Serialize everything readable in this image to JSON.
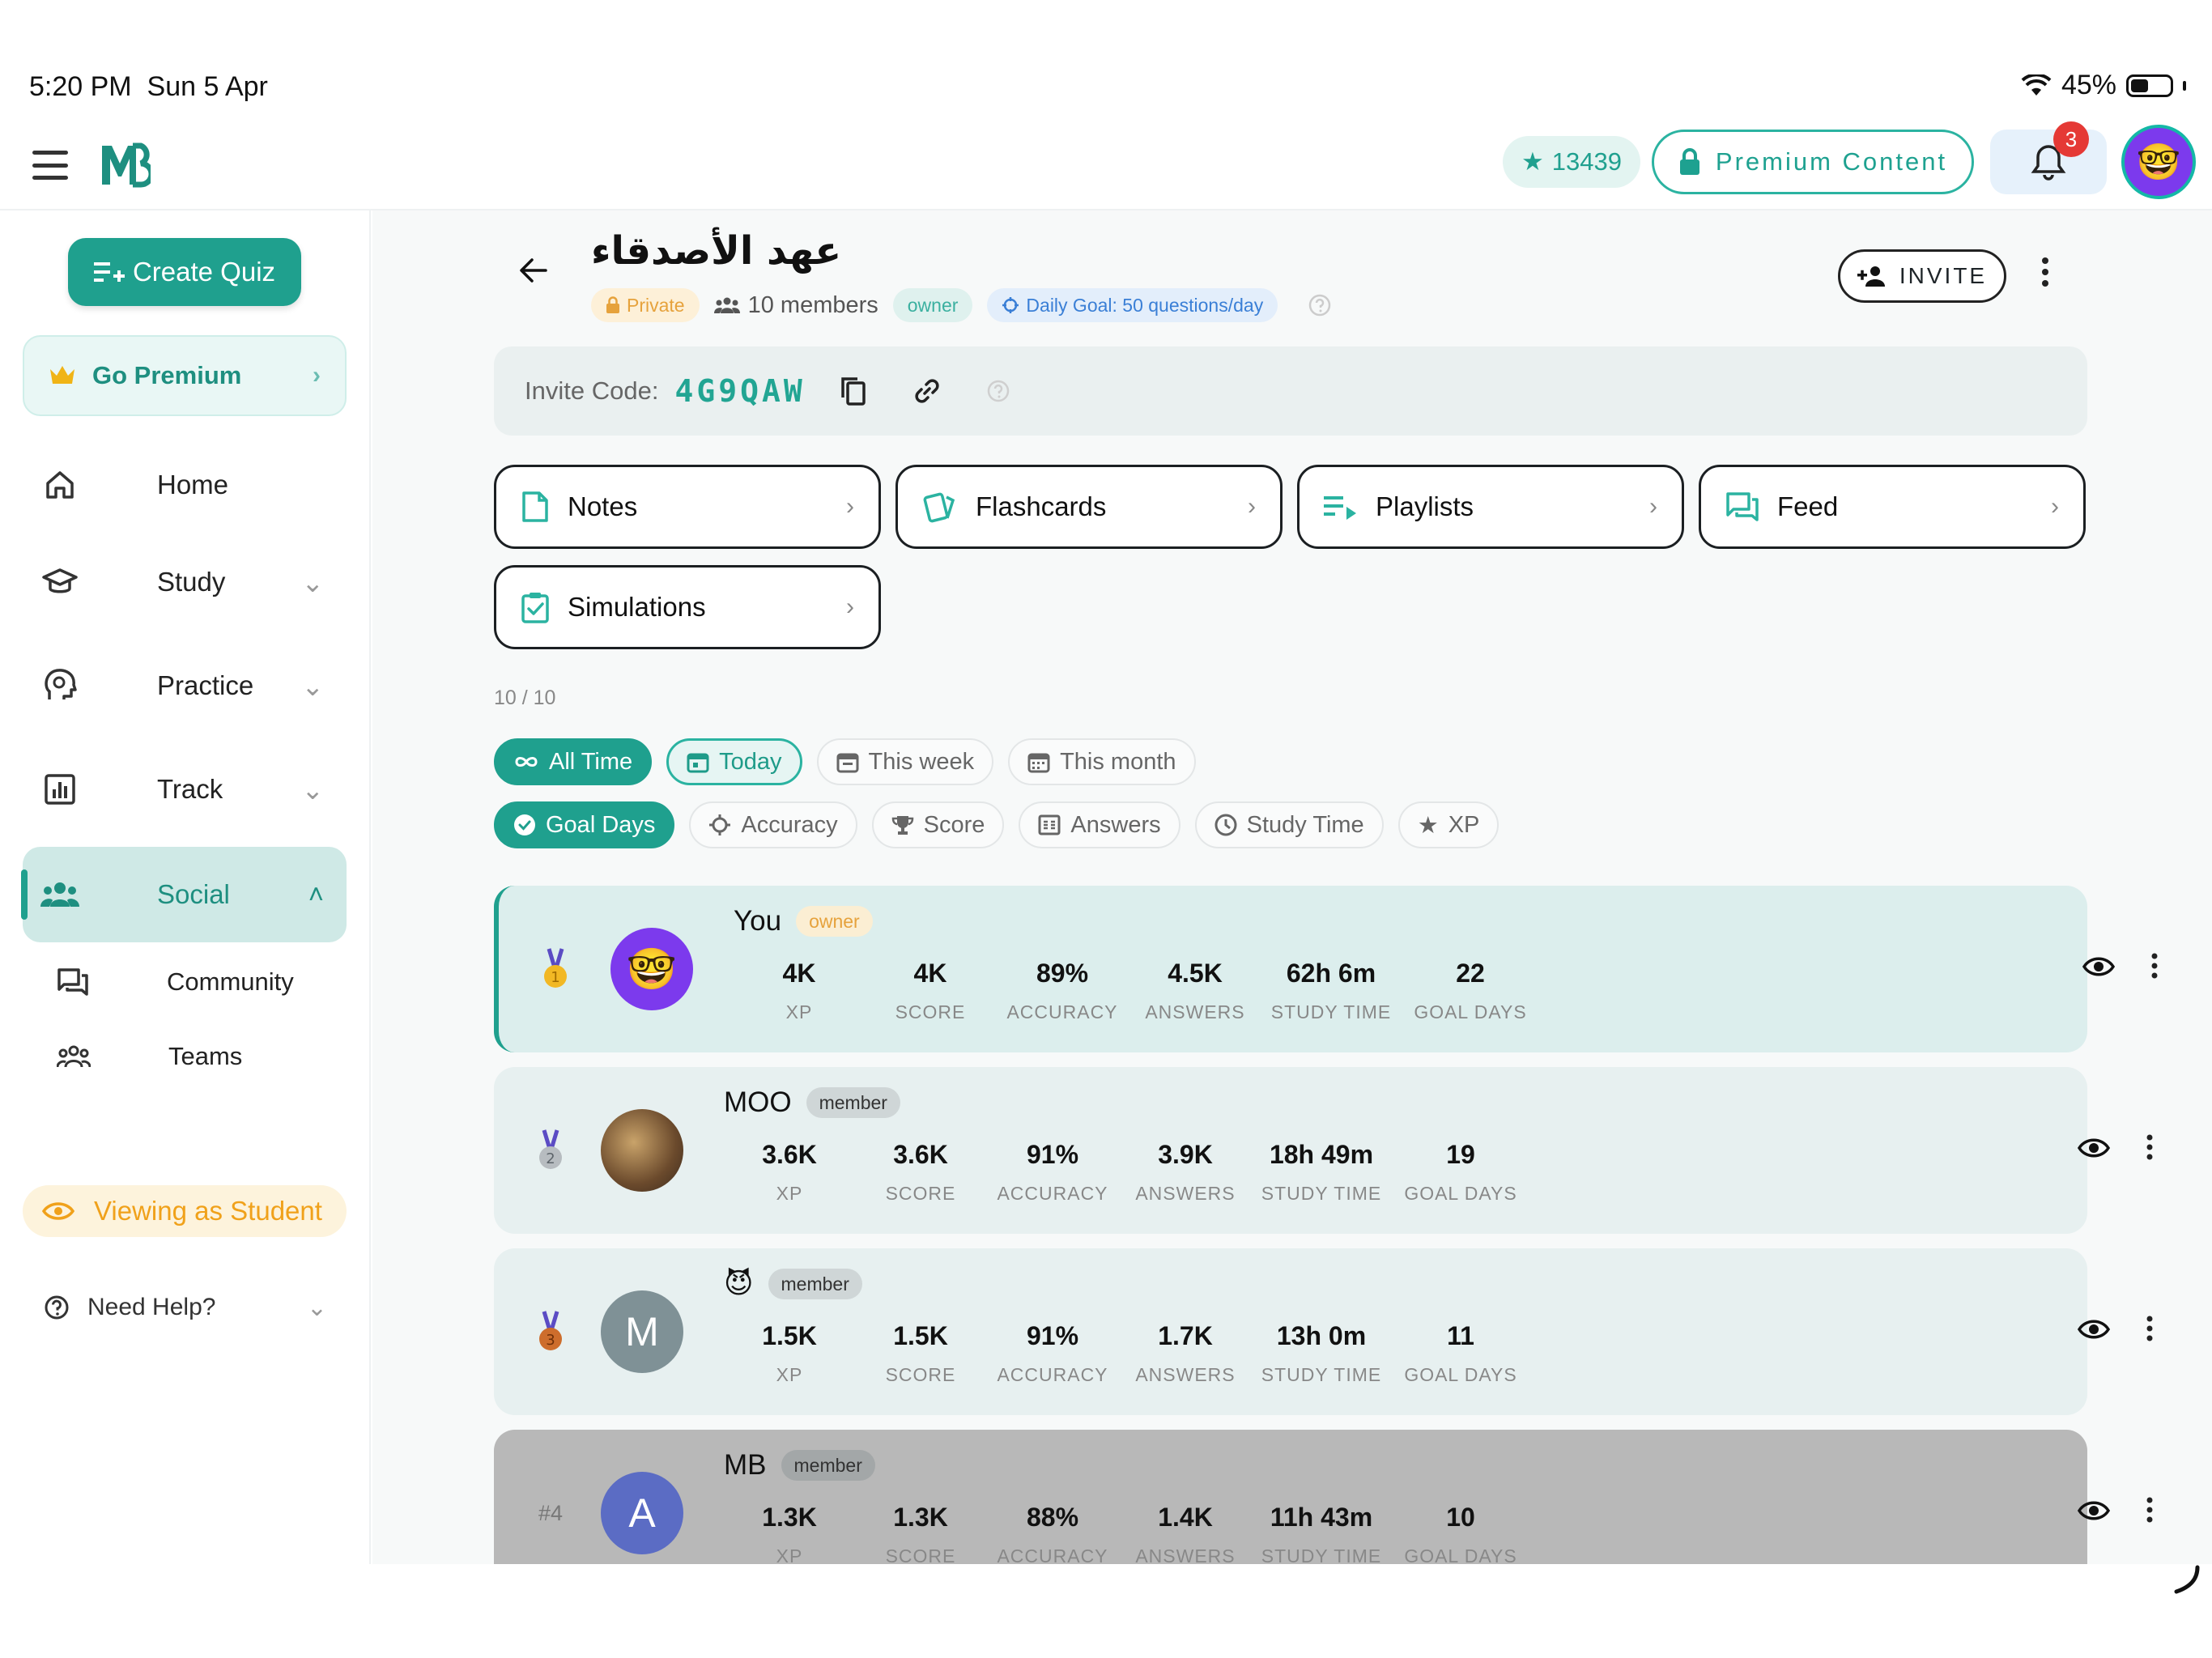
{
  "status": {
    "time": "5:20 PM",
    "date": "Sun 5 Apr",
    "battery": "45%",
    "battery_level": 0.45
  },
  "topbar": {
    "xp": "13439",
    "premium_label": "Premium Content",
    "notifications": "3",
    "avatar_emoji": "🤓"
  },
  "sidebar": {
    "create_quiz": "Create Quiz",
    "go_premium": "Go Premium",
    "items": [
      {
        "label": "Home",
        "icon": "home-icon"
      },
      {
        "label": "Study",
        "icon": "graduation-cap-icon"
      },
      {
        "label": "Practice",
        "icon": "brain-icon"
      },
      {
        "label": "Track",
        "icon": "chart-icon"
      },
      {
        "label": "Social",
        "icon": "people-icon"
      }
    ],
    "subitems": [
      {
        "label": "Community",
        "icon": "chat-icon"
      },
      {
        "label": "Teams",
        "icon": "team-icon"
      }
    ],
    "viewing_as": "Viewing as Student",
    "need_help": "Need Help?"
  },
  "group": {
    "title": "عهد الأصدقاء",
    "privacy": "Private",
    "members": "10 members",
    "role": "owner",
    "daily_goal": "Daily Goal: 50 questions/day",
    "invite_label": "INVITE",
    "invite_code_label": "Invite Code:",
    "invite_code": "4G9QAW"
  },
  "resources": [
    "Notes",
    "Flashcards",
    "Playlists",
    "Feed",
    "Simulations"
  ],
  "count": "10 / 10",
  "time_filters": [
    "All Time",
    "Today",
    "This week",
    "This month"
  ],
  "metric_filters": [
    "Goal Days",
    "Accuracy",
    "Score",
    "Answers",
    "Study Time",
    "XP"
  ],
  "stat_labels": [
    "XP",
    "SCORE",
    "ACCURACY",
    "ANSWERS",
    "STUDY TIME",
    "GOAL DAYS"
  ],
  "members": [
    {
      "rank": "1",
      "name": "You",
      "role": "owner",
      "avatar": "🤓",
      "stats": [
        "4K",
        "4K",
        "89%",
        "4.5K",
        "62h 6m",
        "22"
      ]
    },
    {
      "rank": "2",
      "name": "MOO",
      "role": "member",
      "avatar": "",
      "stats": [
        "3.6K",
        "3.6K",
        "91%",
        "3.9K",
        "18h 49m",
        "19"
      ]
    },
    {
      "rank": "3",
      "name": "😈",
      "role": "member",
      "avatar": "M",
      "stats": [
        "1.5K",
        "1.5K",
        "91%",
        "1.7K",
        "13h 0m",
        "11"
      ]
    },
    {
      "rank": "#4",
      "name": "MB",
      "role": "member",
      "avatar": "A",
      "stats": [
        "1.3K",
        "1.3K",
        "88%",
        "1.4K",
        "11h 43m",
        "10"
      ]
    }
  ],
  "colors": {
    "accent": "#1fa08e",
    "premium": "#f0a11a",
    "notification": "#e53935",
    "avatar_purple": "#7c3aed"
  }
}
